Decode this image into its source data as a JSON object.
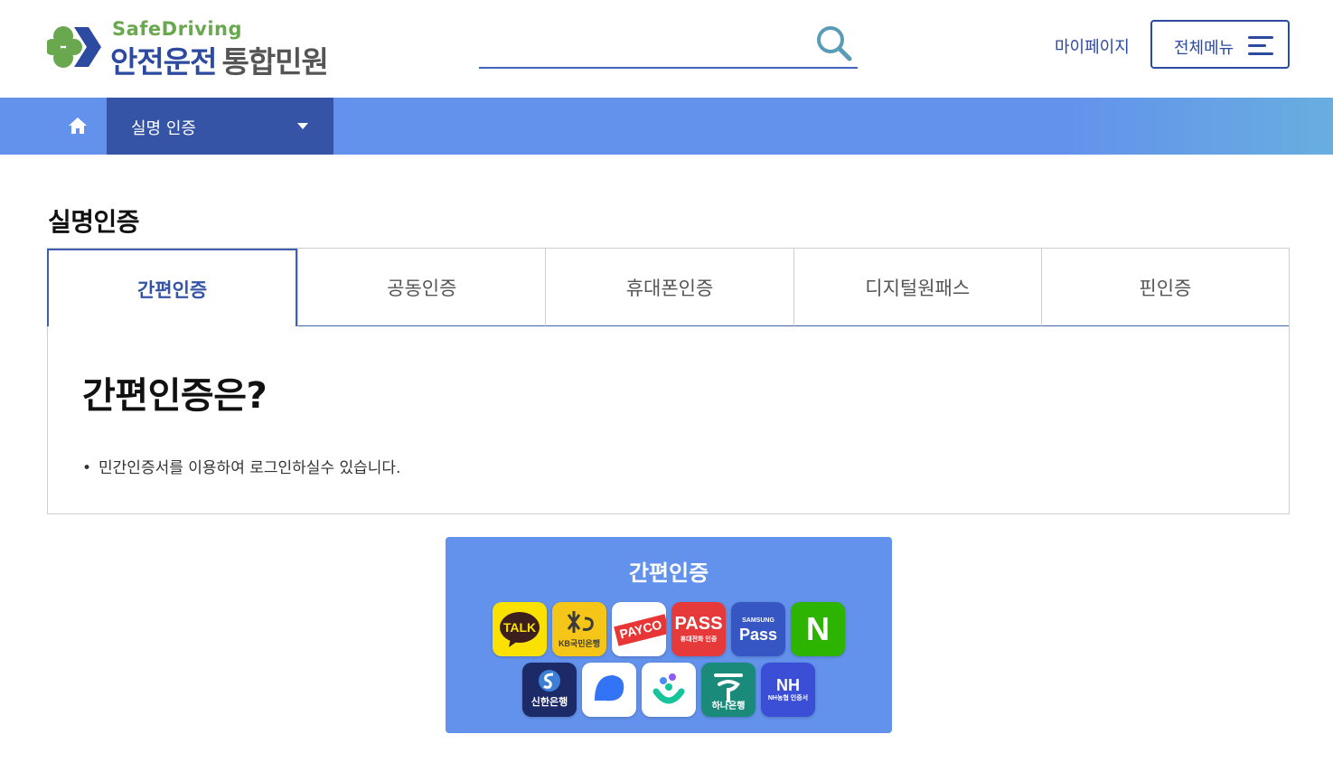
{
  "header": {
    "logo_en": "SafeDriving",
    "logo_ko_main": "안전운전",
    "logo_ko_sub": "통합민원",
    "search": {
      "placeholder": "",
      "value": ""
    },
    "mypage_label": "마이페이지",
    "allmenu_label": "전체메뉴"
  },
  "nav": {
    "selected_label": "실명 인증"
  },
  "page_title": "실명인증",
  "tabs": [
    {
      "label": "간편인증",
      "active": true
    },
    {
      "label": "공동인증",
      "active": false
    },
    {
      "label": "휴대폰인증",
      "active": false
    },
    {
      "label": "디지털원패스",
      "active": false
    },
    {
      "label": "핀인증",
      "active": false
    }
  ],
  "content": {
    "heading": "간편인증은?",
    "bullet": "•",
    "description": "민간인증서를 이용하여 로그인하실수 있습니다."
  },
  "auth_card": {
    "title": "간편인증",
    "apps": [
      {
        "icon": "kakao-talk-icon",
        "text": "TALK"
      },
      {
        "icon": "kb-bank-icon",
        "text": "KB국민은행"
      },
      {
        "icon": "payco-icon",
        "text": "PAYCO"
      },
      {
        "icon": "pass-icon",
        "text": "PASS",
        "sub": "휴대전화 인증"
      },
      {
        "icon": "samsung-pass-icon",
        "text": "Pass",
        "sub": "SAMSUNG"
      },
      {
        "icon": "naver-icon",
        "text": "N"
      },
      {
        "icon": "shinhan-bank-icon",
        "text": "신한은행"
      },
      {
        "icon": "toss-icon",
        "text": ""
      },
      {
        "icon": "banksalad-icon",
        "text": ""
      },
      {
        "icon": "hana-bank-icon",
        "text": "하나은행"
      },
      {
        "icon": "nh-bank-icon",
        "text": "NH",
        "sub": "NH농협 인증서"
      }
    ]
  },
  "colors": {
    "brand_blue": "#2c4aa0",
    "nav_blue": "#6392ec",
    "nav_dark": "#3554a5",
    "brand_green": "#6aa84f"
  }
}
